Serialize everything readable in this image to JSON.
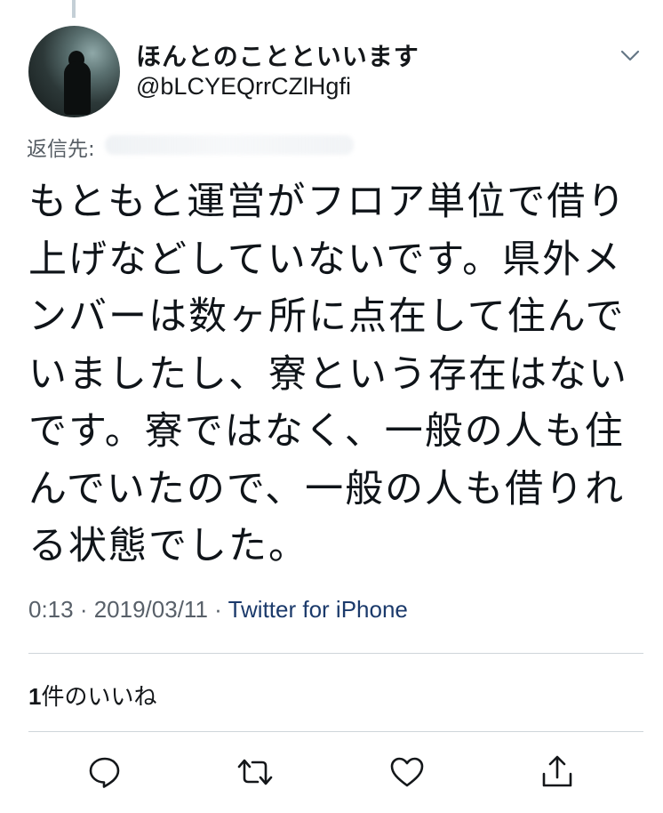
{
  "tweet": {
    "display_name": "ほんとのことといいます",
    "handle": "@bLCYEQrrCZlHgfi",
    "reply_to_label": "返信先:",
    "body": "もともと運営がフロア単位で借り\n上げなどしていないです。県外メ\nンバーは数ヶ所に点在して住んで\nいましたし、寮という存在はない\nです。寮ではなく、一般の人も住\nんでいたので、一般の人も借りれ\nる状態でした。",
    "time": "0:13",
    "date": "2019/03/11",
    "separator": " · ",
    "source": "Twitter for iPhone",
    "likes_count": "1",
    "likes_label": "件のいいね"
  },
  "icons": {
    "menu": "chevron-down-icon",
    "reply": "reply-icon",
    "retweet": "retweet-icon",
    "like": "heart-icon",
    "share": "share-icon"
  },
  "colors": {
    "text": "#14171a",
    "muted": "#586069",
    "source_link": "#1b3a6b",
    "divider": "#cfd5da"
  }
}
